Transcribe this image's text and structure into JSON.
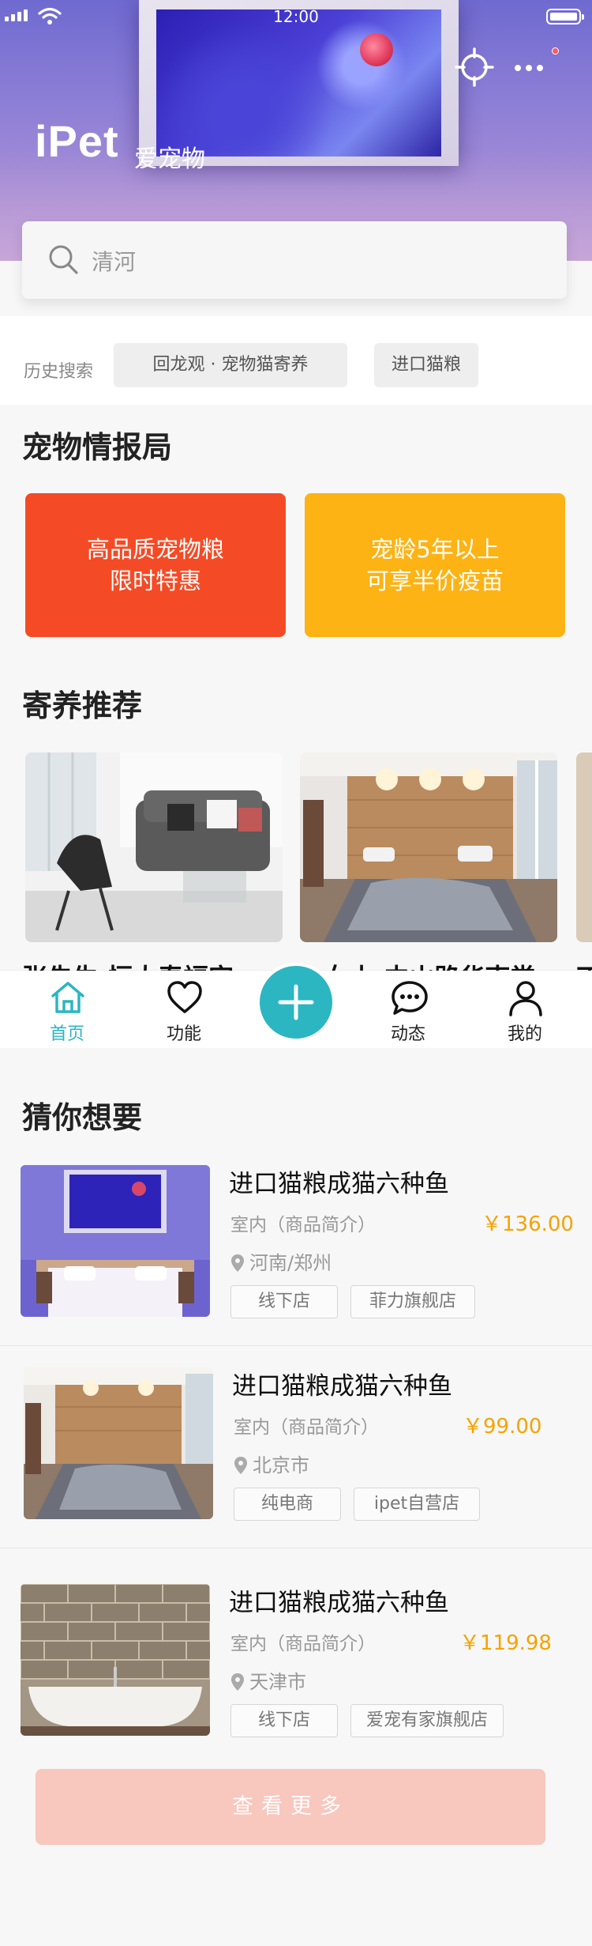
{
  "status_bar": {
    "time": "12:00"
  },
  "brand": {
    "name": "iPet",
    "subtitle": "爱宠物"
  },
  "search": {
    "placeholder": "清河"
  },
  "history": {
    "label": "历史搜索",
    "items": [
      "回龙观 · 宠物猫寄养",
      "进口猫粮"
    ]
  },
  "intel": {
    "title": "宠物情报局",
    "cards": [
      {
        "line1": "高品质宠物粮",
        "line2": "限时特惠",
        "color": "#f44b26"
      },
      {
        "line1": "宠龄5年以上",
        "line2": "可享半价疫苗",
        "color": "#fdb314"
      }
    ]
  },
  "foster": {
    "title": "寄养推荐",
    "captions": [
      "张先生·恒大春福宫",
      "·女士·中山路华南堂",
      "丁"
    ]
  },
  "tabbar": {
    "tabs": [
      {
        "label": "首页",
        "icon": "home-icon",
        "active": true
      },
      {
        "label": "功能",
        "icon": "heart-icon"
      },
      {
        "label": "动态",
        "icon": "chat-icon"
      },
      {
        "label": "我的",
        "icon": "user-icon"
      }
    ],
    "accent": "#2bb6c2"
  },
  "guess": {
    "title": "猜你想要",
    "items": [
      {
        "title": "进口猫粮成猫六种鱼",
        "desc": "室内（商品简介）",
        "price": "￥136.00",
        "location": "河南/郑州",
        "tags": [
          "线下店",
          "菲力旗舰店"
        ]
      },
      {
        "title": "进口猫粮成猫六种鱼",
        "desc": "室内（商品简介）",
        "price": "￥99.00",
        "location": "北京市",
        "tags": [
          "纯电商",
          "ipet自营店"
        ]
      },
      {
        "title": "进口猫粮成猫六种鱼",
        "desc": "室内（商品简介）",
        "price": "￥119.98",
        "location": "天津市",
        "tags": [
          "线下店",
          "爱宠有家旗舰店"
        ]
      }
    ]
  },
  "more_button": {
    "label": "查看更多"
  },
  "colors": {
    "price": "#f5a300",
    "more_button_bg": "#f8c7bd"
  }
}
